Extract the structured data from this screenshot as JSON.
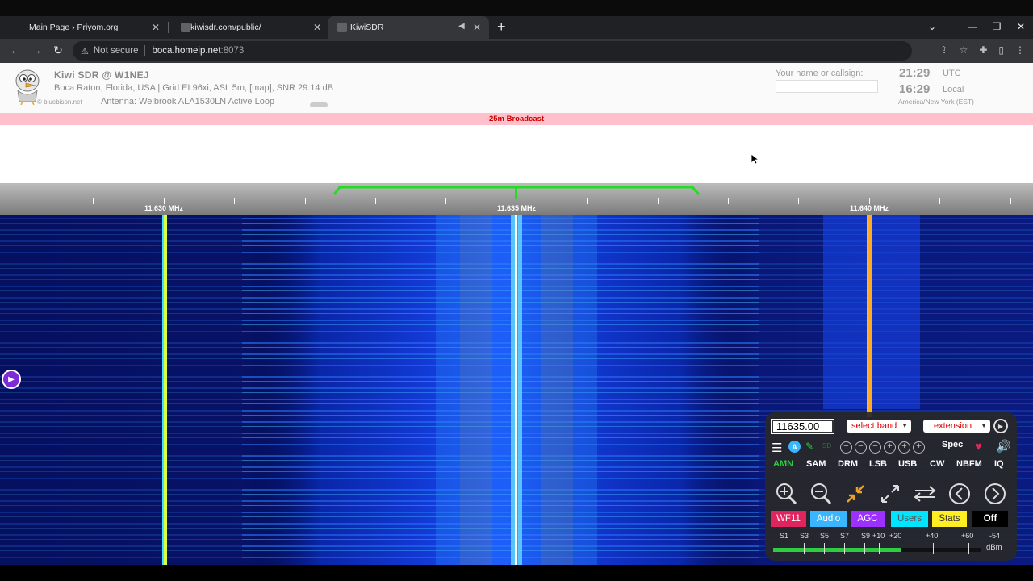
{
  "browser": {
    "tabs": [
      {
        "title": "Main Page › Priyom.org",
        "active": false
      },
      {
        "title": "kiwisdr.com/public/",
        "active": false
      },
      {
        "title": "KiwiSDR",
        "active": true
      }
    ],
    "address": {
      "security_label": "Not secure",
      "host": "boca.homeip.net",
      "port": ":8073"
    }
  },
  "kiwi": {
    "title": "Kiwi SDR @ W1NEJ",
    "location": "Boca Raton, Florida, USA | Grid EL96xi, ASL 5m, [map], SNR 29:14 dB",
    "antenna": "Antenna: Welbrook ALA1530LN Active Loop",
    "credit": "© bluebison.net",
    "callsign_label": "Your name or callsign:",
    "time_utc": "21:29",
    "utc_label": "UTC",
    "time_local": "16:29",
    "local_label": "Local",
    "timezone": "America/New York (EST)",
    "band_label": "25m Broadcast",
    "scale_labels": [
      "11.630 MHz",
      "11.635 MHz",
      "11.640 MHz"
    ]
  },
  "panel": {
    "frequency": "11635.00",
    "select_band": "select band",
    "extension": "extension",
    "spec_label": "Spec",
    "modes": [
      "AMN",
      "SAM",
      "DRM",
      "LSB",
      "USB",
      "CW",
      "NBFM",
      "IQ"
    ],
    "active_mode": "AMN",
    "tabs": [
      {
        "label": "WF11",
        "color": "#e0245e"
      },
      {
        "label": "Audio",
        "color": "#38b6ff"
      },
      {
        "label": "AGC",
        "color": "#9b30ff"
      },
      {
        "label": "Users",
        "color": "#00e5ff"
      },
      {
        "label": "Stats",
        "color": "#ffee22"
      },
      {
        "label": "Off",
        "color": "#000000"
      }
    ],
    "smeter_scale": [
      "S1",
      "S3",
      "S5",
      "S7",
      "S9",
      "+10",
      "+20",
      "+40",
      "+60"
    ],
    "smeter_value": "-54",
    "smeter_unit": "dBm",
    "smeter_level_fraction": 0.62
  }
}
